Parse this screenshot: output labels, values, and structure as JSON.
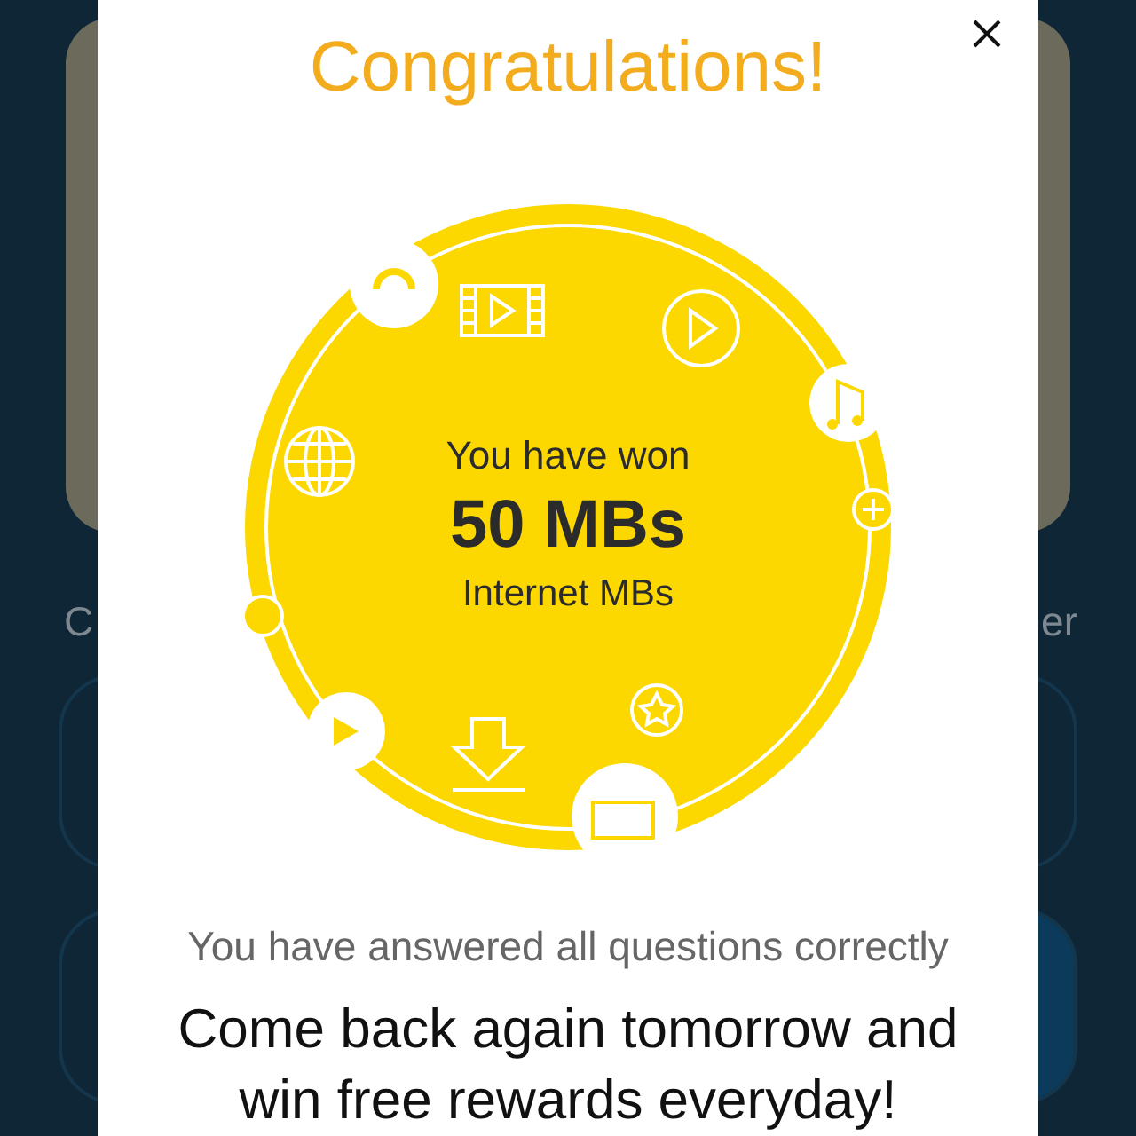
{
  "background": {
    "labels": [
      "C",
      "er"
    ]
  },
  "dialog": {
    "title": "Congratulations!",
    "prize": {
      "intro": "You have won",
      "amount": "50 MBs",
      "unit": "Internet MBs"
    },
    "message": "You have answered all questions correctly",
    "note": "Come back again tomorrow and win free rewards everyday!"
  }
}
